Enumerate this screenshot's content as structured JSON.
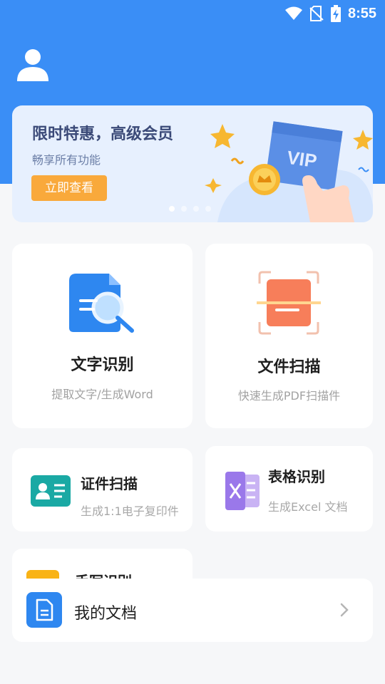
{
  "status": {
    "time": "8:55"
  },
  "banner": {
    "title": "限时特惠，高级会员",
    "subtitle": "畅享所有功能",
    "button": "立即查看",
    "card_text": "VIP"
  },
  "features": [
    {
      "title": "文字识别",
      "subtitle": "提取文字/生成Word"
    },
    {
      "title": "文件扫描",
      "subtitle": "快速生成PDF扫描件"
    },
    {
      "title": "证件扫描",
      "subtitle": "生成1:1电子复印件"
    },
    {
      "title": "表格识别",
      "subtitle": "生成Excel 文档"
    },
    {
      "title": "手写识别"
    }
  ],
  "my_docs": {
    "label": "我的文档"
  },
  "colors": {
    "primary": "#3a8ef6",
    "accent": "#f9a93b",
    "background": "#f6f7f9"
  }
}
